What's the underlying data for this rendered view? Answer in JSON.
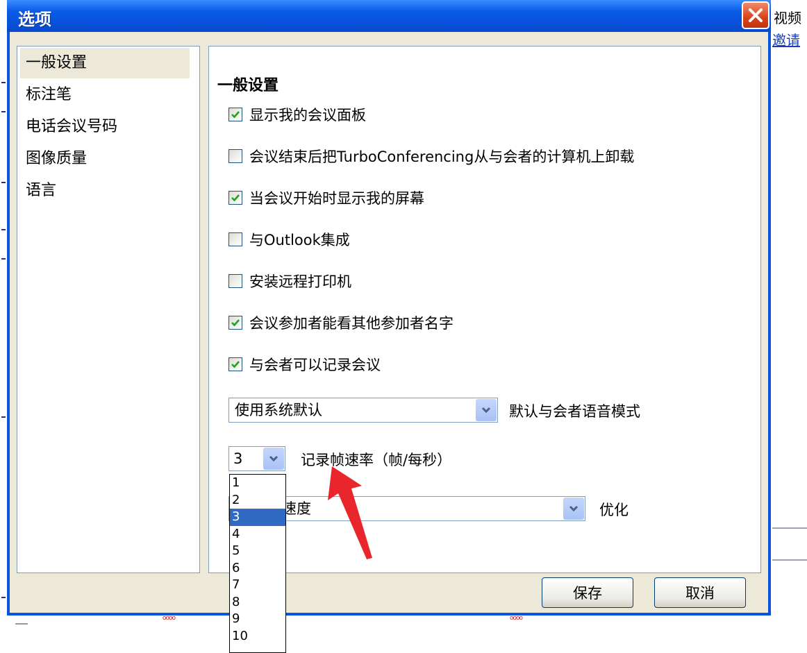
{
  "background": {
    "right_text": "视频",
    "right_link": "邀请"
  },
  "dialog": {
    "title": "选项",
    "close_glyph": "✕"
  },
  "nav": {
    "items": [
      {
        "label": "一般设置",
        "selected": true
      },
      {
        "label": "标注笔",
        "selected": false
      },
      {
        "label": "电话会议号码",
        "selected": false
      },
      {
        "label": "图像质量",
        "selected": false
      },
      {
        "label": "语言",
        "selected": false
      }
    ]
  },
  "general": {
    "section_title": "一般设置",
    "checkboxes": [
      {
        "label": "显示我的会议面板",
        "checked": true
      },
      {
        "label": "会议结束后把TurboConferencing从与会者的计算机上卸载",
        "checked": false
      },
      {
        "label": "当会议开始时显示我的屏幕",
        "checked": true
      },
      {
        "label": "与Outlook集成",
        "checked": false
      },
      {
        "label": "安装远程打印机",
        "checked": false
      },
      {
        "label": "会议参加者能看其他参加者名字",
        "checked": true
      },
      {
        "label": "与会者可以记录会议",
        "checked": true
      }
    ],
    "voice_mode": {
      "value": "使用系统默认",
      "label": "默认与会者语音模式"
    },
    "frame_rate": {
      "value": "3",
      "label": "记录帧速率（帧/每秒）",
      "options": [
        "1",
        "2",
        "3",
        "4",
        "5",
        "6",
        "7",
        "8",
        "9",
        "10"
      ]
    },
    "optimize": {
      "value": "速度",
      "label": "优化"
    }
  },
  "buttons": {
    "save": "保存",
    "cancel": "取消"
  },
  "colors": {
    "titlebar": "#0a5ce8",
    "dialog_face": "#ece9d8",
    "selection": "#316ac5",
    "annotation_arrow": "#e8262b"
  }
}
